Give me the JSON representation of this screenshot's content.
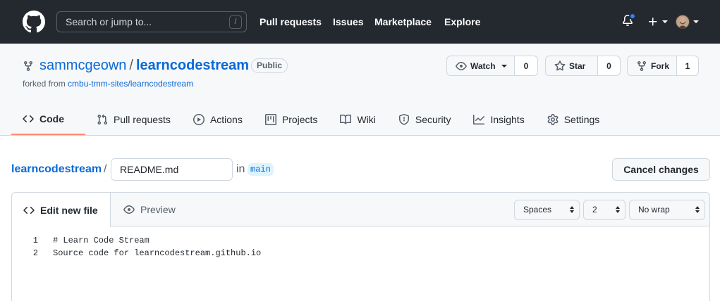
{
  "header": {
    "search_placeholder": "Search or jump to...",
    "search_key_hint": "/",
    "nav": [
      "Pull requests",
      "Issues",
      "Marketplace",
      "Explore"
    ],
    "notification_dot_color": "#2f81f7"
  },
  "repo": {
    "owner": "sammcgeown",
    "separator": "/",
    "name": "learncodestream",
    "visibility": "Public",
    "forked_from_prefix": "forked from",
    "forked_from": "cmbu-tmm-sites/learncodestream",
    "watch": {
      "label": "Watch",
      "count": "0"
    },
    "star": {
      "label": "Star",
      "count": "0"
    },
    "fork": {
      "label": "Fork",
      "count": "1"
    },
    "tabs": [
      {
        "label": "Code",
        "icon": "code-icon"
      },
      {
        "label": "Pull requests",
        "icon": "pull-request-icon"
      },
      {
        "label": "Actions",
        "icon": "play-icon"
      },
      {
        "label": "Projects",
        "icon": "project-icon"
      },
      {
        "label": "Wiki",
        "icon": "book-icon"
      },
      {
        "label": "Security",
        "icon": "shield-icon"
      },
      {
        "label": "Insights",
        "icon": "graph-icon"
      },
      {
        "label": "Settings",
        "icon": "gear-icon"
      }
    ],
    "active_tab_color": "#fd8c73"
  },
  "edit": {
    "breadcrumb_repo": "learncodestream",
    "breadcrumb_sep": "/",
    "filename": "README.md",
    "in_label": "in",
    "branch": "main",
    "cancel_label": "Cancel changes"
  },
  "editor": {
    "tab_edit": "Edit new file",
    "tab_preview": "Preview",
    "indent_mode": "Spaces",
    "indent_size": "2",
    "wrap_mode": "No wrap",
    "lines": [
      {
        "n": "1",
        "text": "# Learn Code Stream"
      },
      {
        "n": "2",
        "text": "Source code for learncodestream.github.io"
      }
    ]
  }
}
